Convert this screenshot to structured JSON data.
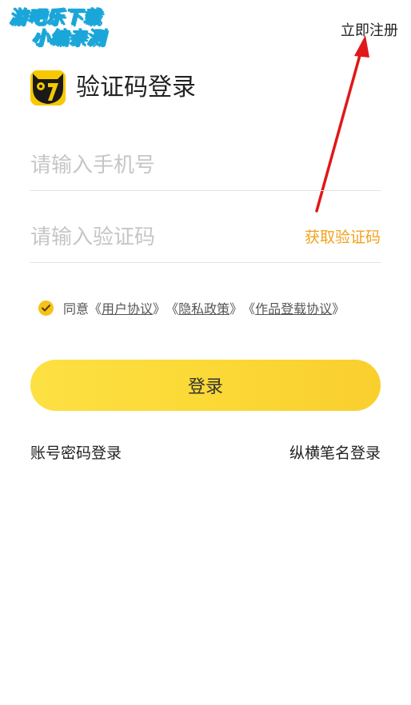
{
  "watermark": {
    "line1": "游吧乐下载",
    "line2": "小编亲测"
  },
  "header": {
    "register_label": "立即注册"
  },
  "login": {
    "title": "验证码登录",
    "phone_placeholder": "请输入手机号",
    "code_placeholder": "请输入验证码",
    "get_code_label": "获取验证码",
    "login_button": "登录"
  },
  "agreement": {
    "prefix": "同意",
    "open_quote": "《",
    "close_quote": "》",
    "user_agreement": "用户协议",
    "privacy_policy": "隐私政策",
    "publish_agreement": "作品登载协议",
    "checked": true
  },
  "alt_login": {
    "password_login": "账号密码登录",
    "zongheng_login": "纵横笔名登录"
  },
  "colors": {
    "accent_yellow": "#f7c800",
    "get_code_orange": "#f2a21c",
    "arrow_red": "#e01818"
  },
  "icons": {
    "brand": "black-cat-logo-icon",
    "check": "check-icon",
    "annotation": "red-arrow-icon"
  }
}
